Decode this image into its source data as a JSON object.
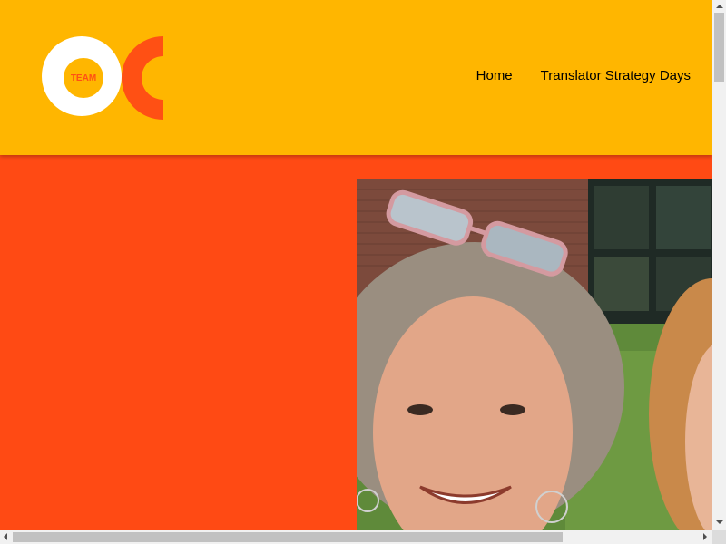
{
  "header": {
    "logo": {
      "word": "TEAM",
      "icon": "team-oc-logo"
    },
    "nav": [
      {
        "label": "Home"
      },
      {
        "label": "Translator Strategy Days"
      }
    ]
  },
  "hero": {
    "image": "photo-of-two-women-selfie-outdoors"
  },
  "colors": {
    "header_bg": "#FFB600",
    "hero_bg": "#FF4A14",
    "logo_white": "#FFFFFF",
    "logo_accent": "#FF5014"
  },
  "scrollbars": {
    "vertical": true,
    "horizontal": true
  }
}
